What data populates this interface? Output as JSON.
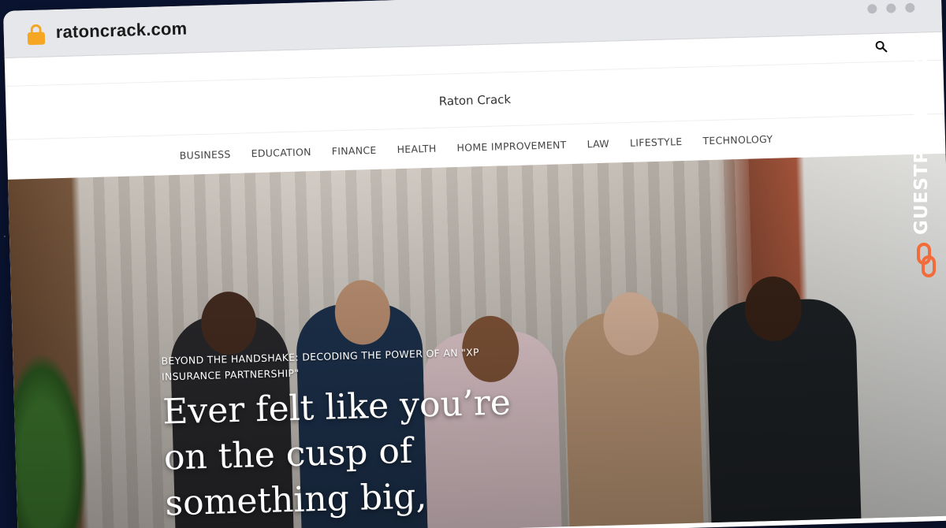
{
  "browser": {
    "url": "ratoncrack.com"
  },
  "site": {
    "title": "Raton Crack",
    "nav": [
      "BUSINESS",
      "EDUCATION",
      "FINANCE",
      "HEALTH",
      "HOME IMPROVEMENT",
      "LAW",
      "LIFESTYLE",
      "TECHNOLOGY"
    ]
  },
  "hero": {
    "kicker": "BEYOND THE HANDSHAKE: DECODING THE POWER OF AN \"XP INSURANCE PARTNERSHIP\"",
    "headline": "Ever felt like you’re on the cusp of something big,"
  },
  "side_brand": {
    "text": "GUESTPOSTLINKS"
  },
  "colors": {
    "lock": "#f5a623",
    "brand_accent": "#f26b3a"
  },
  "icons": {
    "lock": "lock-icon",
    "search": "search-icon",
    "window_dots": "window-dot-icon",
    "brand": "chain-link-icon"
  }
}
